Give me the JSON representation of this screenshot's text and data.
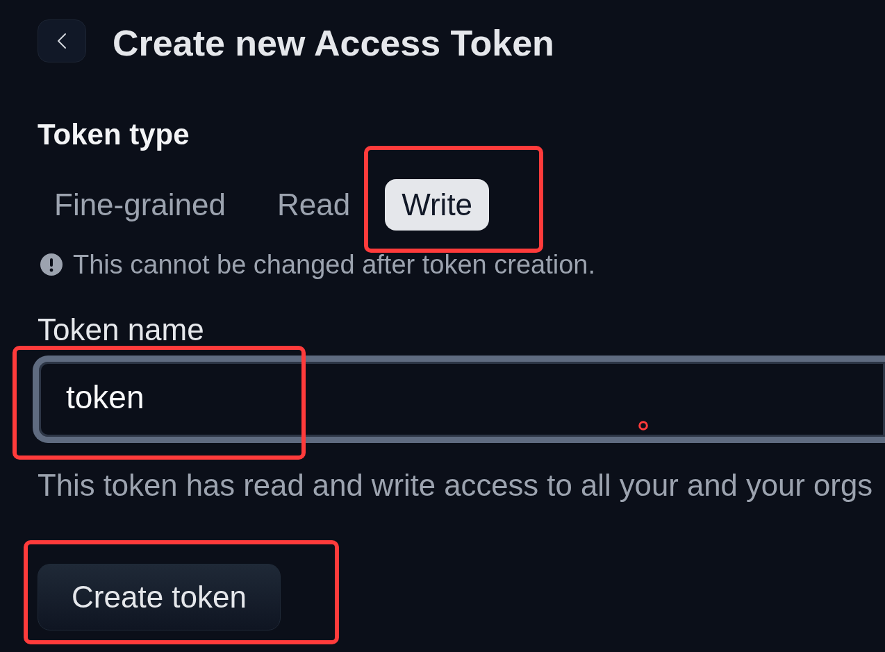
{
  "page": {
    "title": "Create new Access Token"
  },
  "token_type": {
    "label": "Token type",
    "options": [
      {
        "label": "Fine-grained",
        "selected": false,
        "annotated": false
      },
      {
        "label": "Read",
        "selected": false,
        "annotated": false
      },
      {
        "label": "Write",
        "selected": true,
        "annotated": true
      }
    ],
    "note": "This cannot be changed after token creation."
  },
  "token_name": {
    "label": "Token name",
    "value": "token",
    "annotated": true,
    "click_marker": true,
    "help": "This token has read and write access to all your and your orgs"
  },
  "create_button": {
    "label": "Create token",
    "annotated": true
  }
}
